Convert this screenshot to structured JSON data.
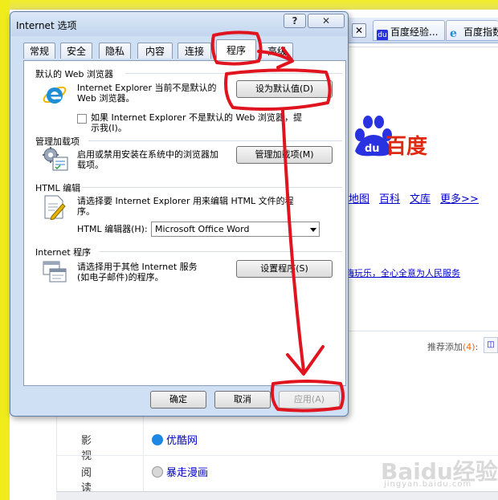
{
  "dialog": {
    "title": "Internet 选项",
    "help_label": "?",
    "close_label": "✕",
    "tabs": [
      {
        "label": "常规"
      },
      {
        "label": "安全"
      },
      {
        "label": "隐私"
      },
      {
        "label": "内容"
      },
      {
        "label": "连接"
      },
      {
        "label": "程序"
      },
      {
        "label": "高级"
      }
    ],
    "active_tab": "程序",
    "default_browser": {
      "title": "默认的 Web 浏览器",
      "status_line1": "Internet Explorer 当前不是默认的",
      "status_line2": "Web 浏览器。",
      "set_default_button": "设为默认值(D)",
      "notify_line1": "如果 Internet Explorer 不是默认的 Web 浏览器，提",
      "notify_line2": "示我(I)。",
      "notify_checked": false
    },
    "addons": {
      "title": "管理加载项",
      "desc_line1": "启用或禁用安装在系统中的浏览器加",
      "desc_line2": "载项。",
      "button": "管理加载项(M)"
    },
    "html_edit": {
      "title": "HTML 编辑",
      "desc_line1": "请选择要 Internet Explorer 用来编辑 HTML 文件的程",
      "desc_line2": "序。",
      "editor_label": "HTML 编辑器(H):",
      "editor_value": "Microsoft Office Word"
    },
    "programs": {
      "title": "Internet 程序",
      "desc_line1": "请选择用于其他 Internet 服务",
      "desc_line2": "(如电子邮件)的程序。",
      "button": "设置程序(S)"
    },
    "footer": {
      "ok": "确定",
      "cancel": "取消",
      "apply": "应用(A)"
    }
  },
  "browser": {
    "tab_close": "✕",
    "tabs": [
      {
        "label": "百度经验..."
      },
      {
        "label": "百度指数"
      }
    ],
    "logo_text": "百度",
    "nav_links": [
      "地图",
      "百科",
      "文库",
      "更多>>"
    ],
    "slogan": "嗨玩乐，全心全意为人民服务",
    "recommend_label": "推荐添加",
    "recommend_count": "(4)",
    "recommend_sep": ":",
    "lower_rows": [
      {
        "category": "影视",
        "site": "优酷网"
      },
      {
        "category": "阅读",
        "site": "暴走漫画"
      }
    ],
    "watermark": "Baidu经验",
    "watermark_sub": "jingyan.baidu.com"
  },
  "colors": {
    "annotation_red": "#e0141e",
    "dialog_frame": "#cfdff4",
    "desktop_yellow": "#f0ec1c",
    "baidu_blue": "#2932e1",
    "baidu_red": "#de2910"
  }
}
